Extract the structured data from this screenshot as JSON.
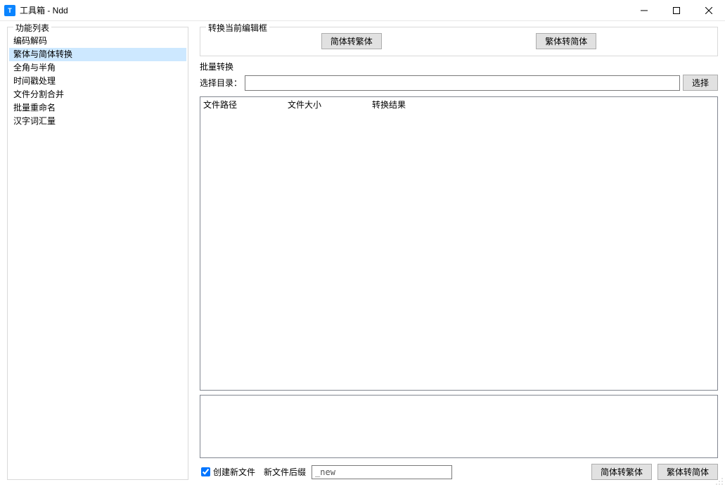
{
  "window": {
    "title": "工具箱 - Ndd"
  },
  "sidebar": {
    "title": "功能列表",
    "items": [
      {
        "label": "编码解码"
      },
      {
        "label": "繁体与简体转换"
      },
      {
        "label": "全角与半角"
      },
      {
        "label": "时间戳处理"
      },
      {
        "label": "文件分割合并"
      },
      {
        "label": "批量重命名"
      },
      {
        "label": "汉字词汇量"
      }
    ],
    "selected_index": 1
  },
  "current_group": {
    "title": "转换当前编辑框",
    "btn_s2t": "简体转繁体",
    "btn_t2s": "繁体转简体"
  },
  "batch": {
    "title": "批量转换",
    "dir_label": "选择目录：",
    "dir_value": "",
    "choose_btn": "选择",
    "columns": {
      "path": "文件路径",
      "size": "文件大小",
      "result": "转换结果"
    }
  },
  "bottom": {
    "create_new_file_label": "创建新文件",
    "create_new_file_checked": true,
    "suffix_label": "新文件后缀",
    "suffix_value": "_new",
    "btn_s2t": "简体转繁体",
    "btn_t2s": "繁体转简体"
  }
}
